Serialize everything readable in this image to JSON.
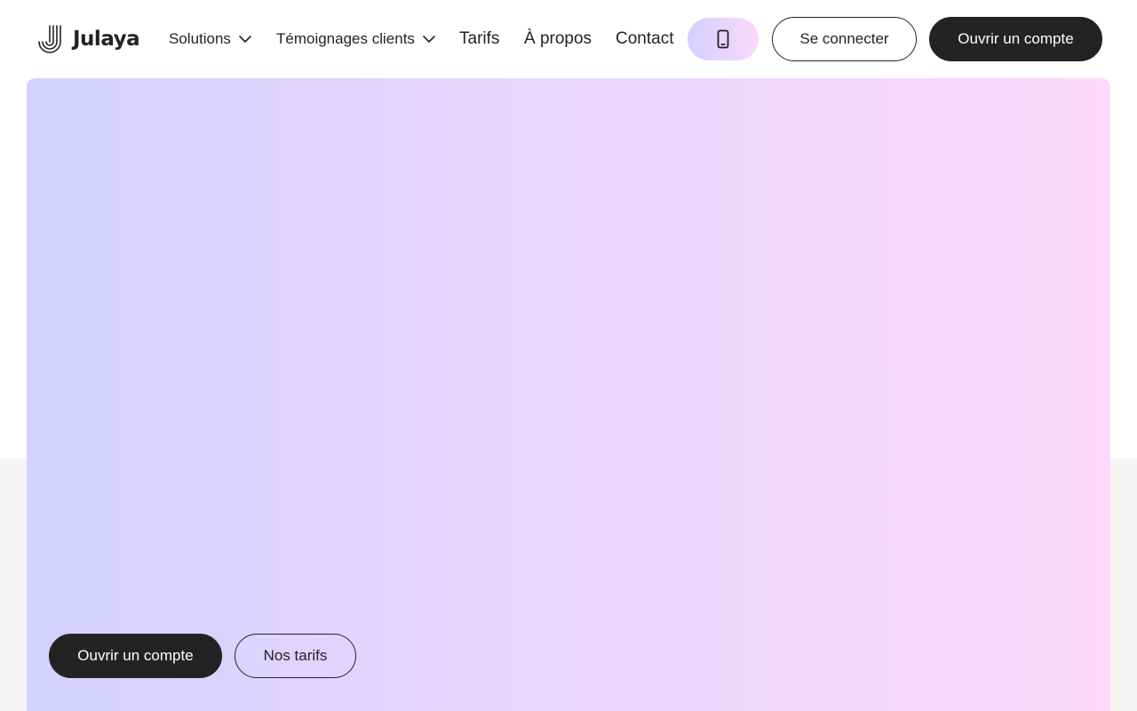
{
  "brand": {
    "name": "Julaya",
    "logo_icon": "julaya-logo-icon"
  },
  "nav": {
    "items": [
      {
        "label": "Solutions",
        "has_dropdown": true
      },
      {
        "label": "Témoignages clients",
        "has_dropdown": true
      },
      {
        "label": "Tarifs",
        "has_dropdown": false
      },
      {
        "label": "À propos",
        "has_dropdown": false
      },
      {
        "label": "Contact",
        "has_dropdown": false
      }
    ],
    "phone_button_icon": "smartphone-icon",
    "login_label": "Se connecter",
    "signup_label": "Ouvrir un compte"
  },
  "hero": {
    "primary_cta": "Ouvrir un compte",
    "secondary_cta": "Nos tarifs"
  },
  "colors": {
    "text": "#232323",
    "dark_button": "#232323",
    "gradient_start": "#d3d1ff",
    "gradient_end": "#fdd9fb",
    "page_lower_bg": "#f7f5f3"
  }
}
